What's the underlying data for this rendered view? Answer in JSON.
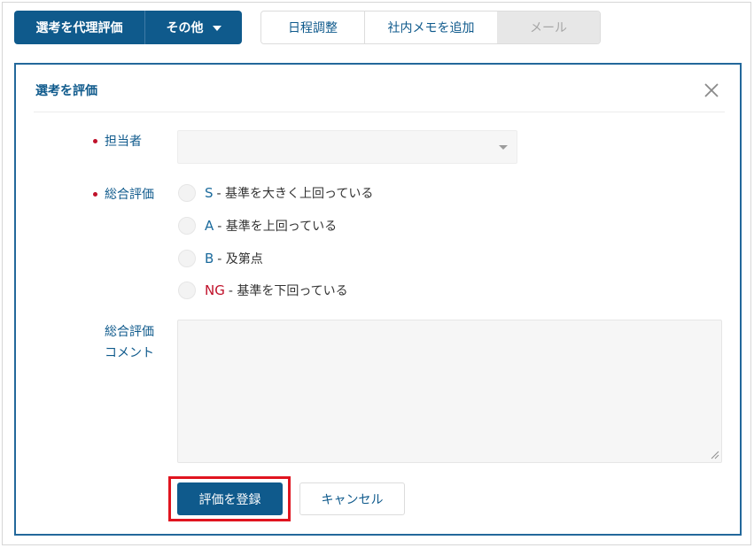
{
  "toolbar": {
    "delegate_eval_label": "選考を代理評価",
    "other_label": "その他",
    "schedule_label": "日程調整",
    "memo_label": "社内メモを追加",
    "mail_label": "メール"
  },
  "panel": {
    "title": "選考を評価"
  },
  "form": {
    "assignee": {
      "label": "担当者",
      "value": ""
    },
    "overall_rating": {
      "label": "総合評価",
      "options": [
        {
          "grade": "S",
          "description": " - 基準を大きく上回っている"
        },
        {
          "grade": "A",
          "description": " - 基準を上回っている"
        },
        {
          "grade": "B",
          "description": " - 及第点"
        },
        {
          "grade": "NG",
          "description": " - 基準を下回っている"
        }
      ]
    },
    "comment": {
      "label_line1": "総合評価",
      "label_line2": "コメント",
      "value": ""
    },
    "submit_label": "評価を登録",
    "cancel_label": "キャンセル"
  },
  "colors": {
    "primary": "#0f5a8c",
    "panel_border": "#23689b",
    "required": "#c0112a",
    "highlight": "#e0141f"
  }
}
